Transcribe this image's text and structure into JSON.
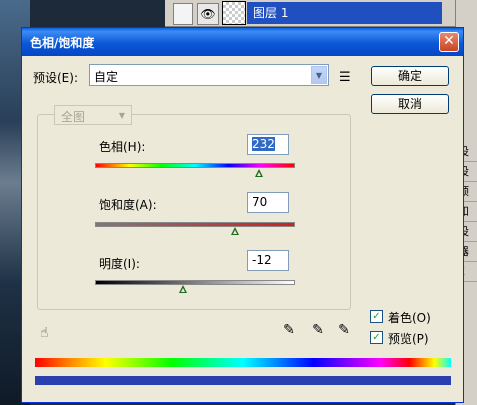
{
  "background": {
    "layer_name": "图层 1",
    "right_panel_items": [
      "设",
      "设",
      "预",
      "和",
      "设",
      "器",
      "E"
    ]
  },
  "dialog": {
    "title": "色相/饱和度",
    "preset_label": "预设(E):",
    "preset_value": "自定",
    "ok_label": "确定",
    "cancel_label": "取消",
    "edit_value": "全图",
    "hue": {
      "label": "色相(H):",
      "value": "232",
      "fraction": 0.82
    },
    "saturation": {
      "label": "饱和度(A):",
      "value": "70",
      "fraction": 0.7
    },
    "lightness": {
      "label": "明度(I):",
      "value": "-12",
      "fraction": 0.44
    },
    "colorize": {
      "label": "着色(O)",
      "checked": true
    },
    "preview": {
      "label": "预览(P)",
      "checked": true
    }
  },
  "colors": {
    "title_bar": "#0a5fe0",
    "dialog_bg": "#ece9d8",
    "accent": "#316ac5"
  }
}
